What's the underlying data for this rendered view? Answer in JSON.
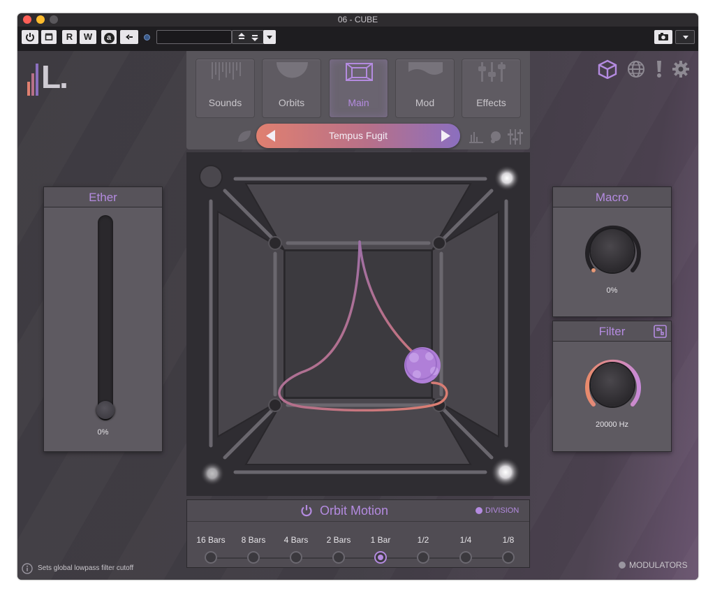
{
  "window": {
    "title": "06 - CUBE"
  },
  "toolbar": {
    "r_label": "R",
    "w_label": "W",
    "a_label": "a",
    "preset_field_value": ""
  },
  "logo_text": "L.",
  "tabs": [
    {
      "label": "Sounds",
      "active": false
    },
    {
      "label": "Orbits",
      "active": false
    },
    {
      "label": "Main",
      "active": true
    },
    {
      "label": "Mod",
      "active": false
    },
    {
      "label": "Effects",
      "active": false
    }
  ],
  "preset": {
    "name": "Tempus Fugit"
  },
  "ether": {
    "title": "Ether",
    "value": "0%"
  },
  "macro": {
    "title": "Macro",
    "value": "0%"
  },
  "filter": {
    "title": "Filter",
    "value": "20000 Hz"
  },
  "orbit_motion": {
    "title": "Orbit Motion",
    "division_label": "DIVISION",
    "divisions": [
      "16 Bars",
      "8 Bars",
      "4 Bars",
      "2 Bars",
      "1 Bar",
      "1/2",
      "1/4",
      "1/8"
    ],
    "selected": "1 Bar"
  },
  "status": {
    "hint": "Sets global lowpass filter cutoff",
    "modulators_label": "MODULATORS"
  },
  "colors": {
    "accent": "#b48be0",
    "preset_start": "#e08070",
    "preset_end": "#8b6fbf",
    "filter_arc": "#e89a78"
  },
  "icons": [
    "power-icon",
    "box-icon",
    "camera-icon",
    "cube-icon",
    "globe-icon",
    "alert-icon",
    "gear-icon",
    "info-icon",
    "leaf-icon",
    "arrow-left-icon",
    "arrow-right-icon"
  ]
}
